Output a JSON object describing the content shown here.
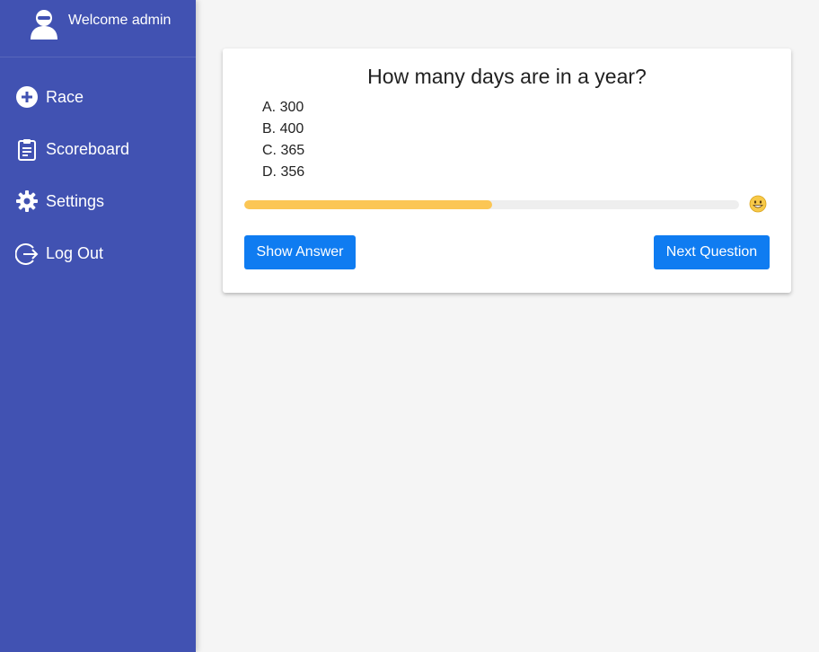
{
  "sidebar": {
    "welcome": "Welcome admin",
    "items": [
      {
        "label": "Race",
        "icon": "plus-circle-icon"
      },
      {
        "label": "Scoreboard",
        "icon": "clipboard-icon"
      },
      {
        "label": "Settings",
        "icon": "gear-icon"
      },
      {
        "label": "Log Out",
        "icon": "logout-icon"
      }
    ],
    "color": "#4152b2"
  },
  "quiz": {
    "question": "How many days are in a year?",
    "options": [
      "A. 300",
      "B. 400",
      "C. 365",
      "D. 356"
    ],
    "progress": 0.5,
    "status_icon": "grinning-face-icon",
    "show_answer_label": "Show Answer",
    "next_question_label": "Next Question"
  },
  "colors": {
    "accent": "#0f7cf1",
    "progress": "#fbc655",
    "background": "#f5f5f5"
  }
}
